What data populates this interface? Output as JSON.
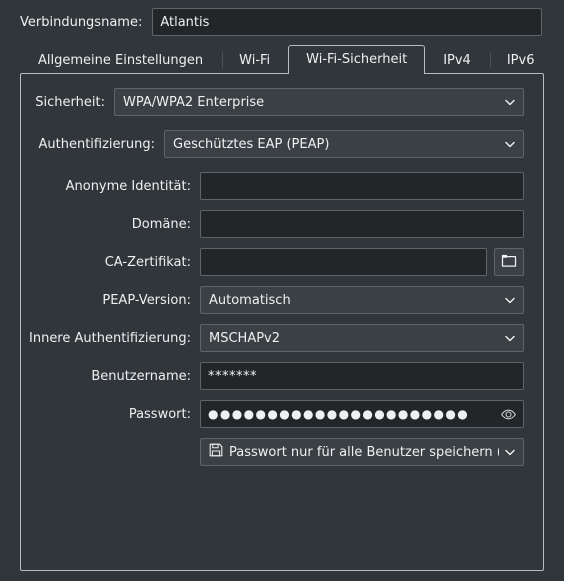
{
  "connection": {
    "label": "Verbindungsname:",
    "value": "Atlantis"
  },
  "tabs": [
    {
      "label": "Allgemeine Einstellungen",
      "active": false
    },
    {
      "label": "Wi-Fi",
      "active": false
    },
    {
      "label": "Wi-Fi-Sicherheit",
      "active": true
    },
    {
      "label": "IPv4",
      "active": false
    },
    {
      "label": "IPv6",
      "active": false
    }
  ],
  "form": {
    "security": {
      "label": "Sicherheit:",
      "value": "WPA/WPA2 Enterprise",
      "icon": "chevron-down-icon"
    },
    "authentication": {
      "label": "Authentifizierung:",
      "value": "Geschütztes EAP (PEAP)",
      "icon": "chevron-down-icon"
    },
    "anonymous_identity": {
      "label": "Anonyme Identität:",
      "value": "",
      "placeholder": ""
    },
    "domain": {
      "label": "Domäne:",
      "value": "",
      "placeholder": ""
    },
    "ca_certificate": {
      "label": "CA-Zertifikat:",
      "value": "",
      "placeholder": "",
      "browse_icon": "folder-icon"
    },
    "peap_version": {
      "label": "PEAP-Version:",
      "value": "Automatisch",
      "icon": "chevron-down-icon"
    },
    "inner_authentication": {
      "label": "Innere Authentifizierung:",
      "value": "MSCHAPv2",
      "icon": "chevron-down-icon"
    },
    "username": {
      "label": "Benutzername:",
      "value": "*******"
    },
    "password": {
      "label": "Passwort:",
      "value": "●●●●●●●●●●●●●●●●●●●●●●",
      "reveal_icon": "eye-icon"
    },
    "password_storage": {
      "value": "Passwort nur für alle Benutzer speichern (unv",
      "icon": "floppy-save-icon",
      "chevron": "chevron-down-icon"
    }
  },
  "colors": {
    "window_bg": "#31363b",
    "input_bg": "#232629",
    "combo_bg": "#3b4045",
    "border": "#5d6569",
    "panel_border": "#b8bcbf",
    "text": "#eff0f1"
  }
}
